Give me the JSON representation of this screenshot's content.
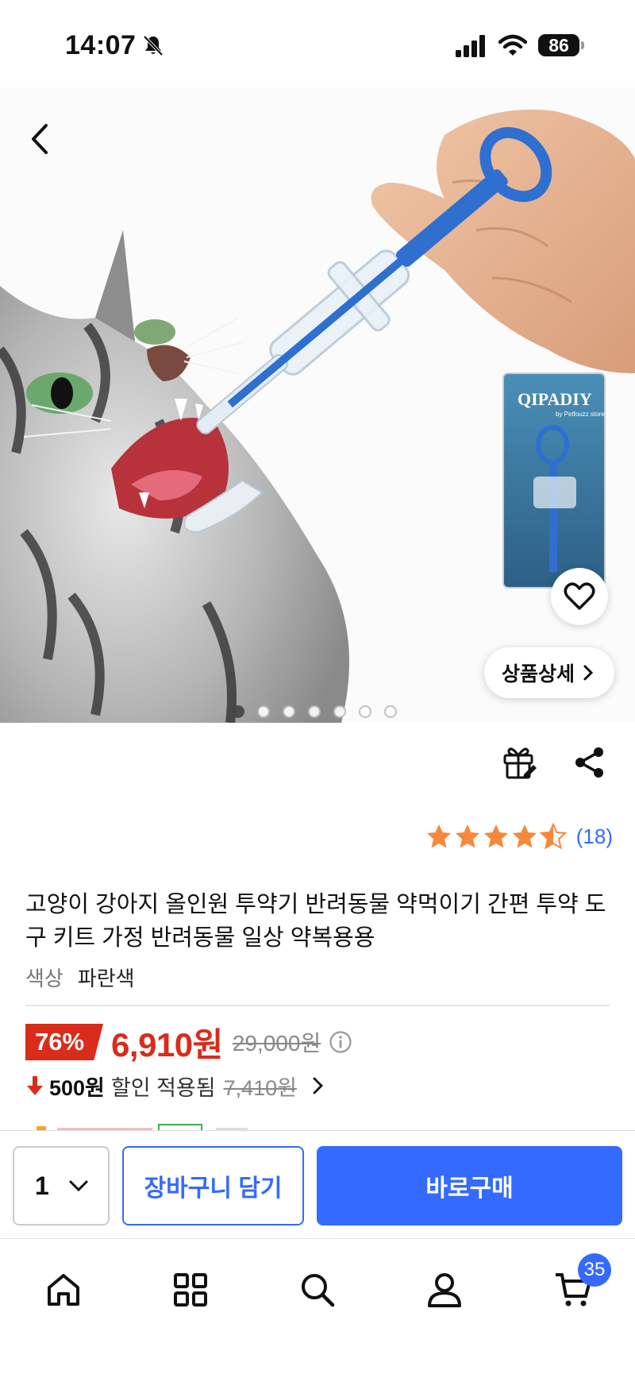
{
  "status_bar": {
    "time": "14:07",
    "battery": "86"
  },
  "hero": {
    "package_brand": "QIPADIY",
    "package_sub": "by Petfouzz store",
    "detail_label": "상품상세",
    "image_count": 7,
    "active_index": 0
  },
  "product": {
    "rating": 4.5,
    "review_count": "(18)",
    "title": "고양이 강아지 올인원 투약기 반려동물 약먹이기 간편 투약 도구 키트 가정 반려동물 일상 약복용용",
    "option_label": "색상",
    "option_value": "파란색",
    "discount": "76%",
    "sale_price": "6,910원",
    "original_price": "29,000원",
    "coupon_amount": "500원",
    "coupon_text": "할인 적용됨",
    "coupon_original": "7,410원"
  },
  "purchase_bar": {
    "quantity": "1",
    "cart_label": "장바구니 담기",
    "buy_label": "바로구매"
  },
  "tab_bar": {
    "items": [
      "home-icon",
      "category-icon",
      "search-icon",
      "user-icon",
      "cart-icon"
    ],
    "cart_badge": "35"
  },
  "colors": {
    "accent": "#346aff",
    "sale": "#d92c1b",
    "star": "#f5883b"
  }
}
